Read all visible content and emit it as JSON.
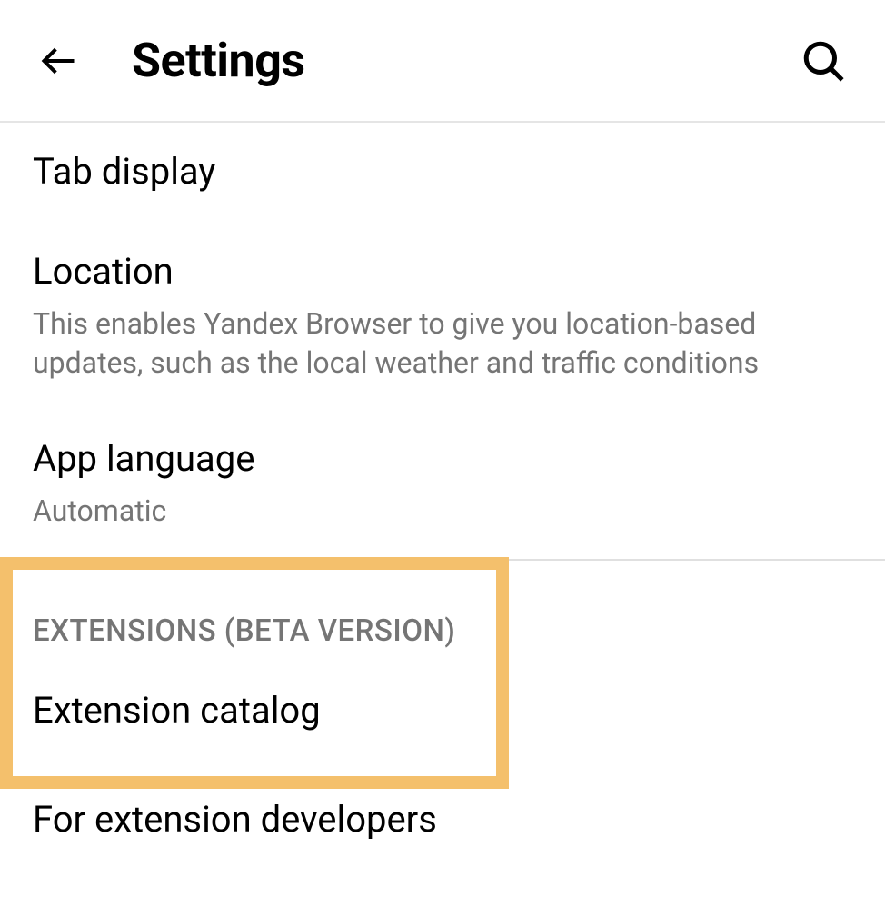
{
  "header": {
    "title": "Settings"
  },
  "items": {
    "tab_display": {
      "title": "Tab display"
    },
    "location": {
      "title": "Location",
      "desc": "This enables Yandex Browser to give you location-based updates, such as the local weather and traffic conditions"
    },
    "app_language": {
      "title": "App language",
      "desc": "Automatic"
    },
    "extensions_section": "EXTENSIONS (BETA VERSION)",
    "extension_catalog": {
      "title": "Extension catalog"
    },
    "for_devs": {
      "title": "For extension developers"
    }
  }
}
